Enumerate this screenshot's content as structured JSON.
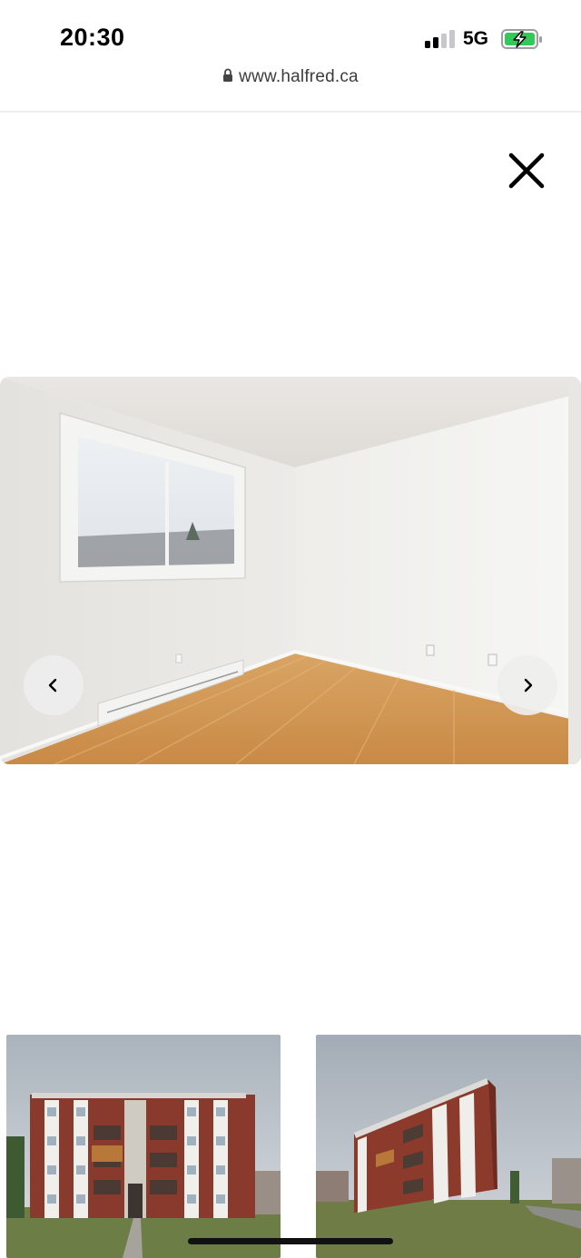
{
  "status_bar": {
    "time": "20:30",
    "network": "5G",
    "icons": [
      "signal-bars-icon",
      "battery-charging-icon"
    ]
  },
  "browser": {
    "url": "www.halfred.ca",
    "icons": [
      "lock-icon"
    ]
  },
  "gallery": {
    "icons": [
      "close-icon",
      "chevron-left-icon",
      "chevron-right-icon"
    ],
    "main_image": "empty-bedroom-photo",
    "thumbnails": [
      "apartment-building-front-photo",
      "apartment-building-side-photo"
    ]
  }
}
